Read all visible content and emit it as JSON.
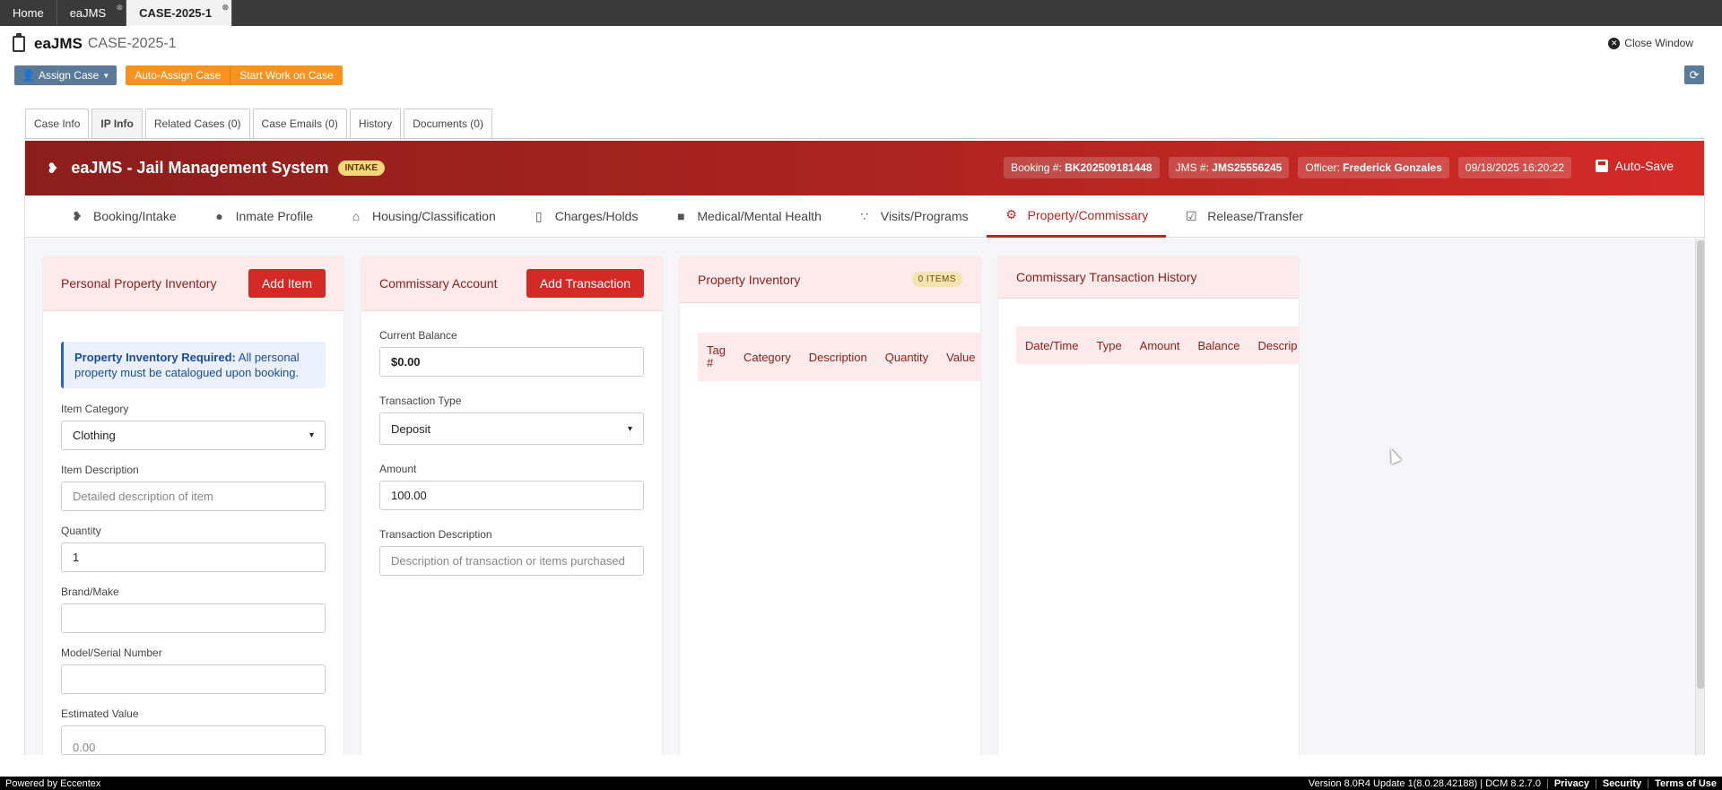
{
  "browser_tabs": [
    {
      "label": "Home"
    },
    {
      "label": "eaJMS"
    },
    {
      "label": "CASE-2025-1"
    }
  ],
  "header": {
    "app_name": "eaJMS",
    "case_id": "CASE-2025-1",
    "close_label": "Close Window"
  },
  "actions": {
    "assign": "Assign Case",
    "auto_assign": "Auto-Assign Case",
    "start_work": "Start Work on Case"
  },
  "case_tabs": [
    {
      "label": "Case Info"
    },
    {
      "label": "IP Info"
    },
    {
      "label": "Related Cases (0)"
    },
    {
      "label": "Case Emails (0)"
    },
    {
      "label": "History"
    },
    {
      "label": "Documents (0)"
    }
  ],
  "system": {
    "title": "eaJMS - Jail Management System",
    "status": "INTAKE",
    "booking_label": "Booking #:",
    "booking_value": "BK202509181448",
    "jms_label": "JMS #:",
    "jms_value": "JMS25556245",
    "officer_label": "Officer:",
    "officer_value": "Frederick Gonzales",
    "datetime": "09/18/2025 16:20:22",
    "autosave": "Auto-Save",
    "accent": "#c12520"
  },
  "modules": [
    {
      "label": "Booking/Intake",
      "icon": "fingerprint-icon"
    },
    {
      "label": "Inmate Profile",
      "icon": "user-icon"
    },
    {
      "label": "Housing/Classification",
      "icon": "home-icon"
    },
    {
      "label": "Charges/Holds",
      "icon": "file-icon"
    },
    {
      "label": "Medical/Mental Health",
      "icon": "briefcase-medical-icon"
    },
    {
      "label": "Visits/Programs",
      "icon": "users-icon"
    },
    {
      "label": "Property/Commissary",
      "icon": "gear-icon"
    },
    {
      "label": "Release/Transfer",
      "icon": "checkbox-icon"
    }
  ],
  "property": {
    "title": "Personal Property Inventory",
    "add_button": "Add Item",
    "alert_bold": "Property Inventory Required:",
    "alert_text": " All personal property must be catalogued upon booking.",
    "category_label": "Item Category",
    "category_value": "Clothing",
    "description_label": "Item Description",
    "description_placeholder": "Detailed description of item",
    "quantity_label": "Quantity",
    "quantity_value": "1",
    "brand_label": "Brand/Make",
    "brand_value": "",
    "model_label": "Model/Serial Number",
    "model_value": "",
    "value_label": "Estimated Value",
    "value_placeholder": "0.00"
  },
  "commissary": {
    "title": "Commissary Account",
    "add_button": "Add Transaction",
    "balance_label": "Current Balance",
    "balance_value": "$0.00",
    "type_label": "Transaction Type",
    "type_value": "Deposit",
    "amount_label": "Amount",
    "amount_value": "100.00",
    "desc_label": "Transaction Description",
    "desc_placeholder": "Description of transaction or items purchased"
  },
  "inventory_table": {
    "title": "Property Inventory",
    "badge": "0 ITEMS",
    "columns": [
      "Tag #",
      "Category",
      "Description",
      "Quantity",
      "Value"
    ]
  },
  "history_table": {
    "title": "Commissary Transaction History",
    "columns": [
      "Date/Time",
      "Type",
      "Amount",
      "Balance",
      "Descrip"
    ]
  },
  "footer": {
    "powered": "Powered by Eccentex",
    "version": "Version  8.0R4 Update 1(8.0.28.42188) | DCM 8.2.7.0",
    "privacy": "Privacy",
    "security": "Security",
    "terms": "Terms of Use"
  }
}
